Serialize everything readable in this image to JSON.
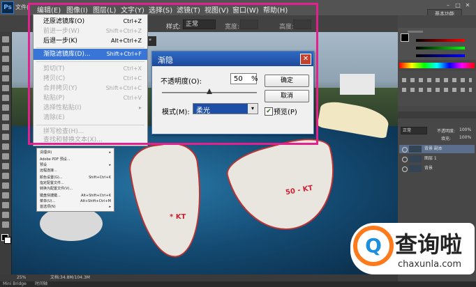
{
  "app": {
    "logo": "Ps",
    "file_menu": "文件(F)",
    "workspace": "基本功能",
    "doc_tab": "B/8) *"
  },
  "menubar": [
    "编辑(E)",
    "图像(I)",
    "图层(L)",
    "文字(Y)",
    "选择(S)",
    "滤镜(T)",
    "视图(V)",
    "窗口(W)",
    "帮助(H)"
  ],
  "options_bar": {
    "style_label": "样式:",
    "style_value": "正常",
    "width_label": "宽度:",
    "height_label": "高度:"
  },
  "edit_menu": {
    "items": [
      {
        "label": "还原滤镜库(O)",
        "shortcut": "Ctrl+Z",
        "state": "normal"
      },
      {
        "label": "前进一步(W)",
        "shortcut": "Shift+Ctrl+Z",
        "state": "disabled"
      },
      {
        "label": "后退一步(K)",
        "shortcut": "Alt+Ctrl+Z",
        "state": "normal"
      },
      {
        "label": "渐隐滤镜库(D)...",
        "shortcut": "Shift+Ctrl+F",
        "state": "highlighted"
      },
      {
        "label": "剪切(T)",
        "shortcut": "Ctrl+X",
        "state": "disabled"
      },
      {
        "label": "拷贝(C)",
        "shortcut": "Ctrl+C",
        "state": "disabled"
      },
      {
        "label": "合并拷贝(Y)",
        "shortcut": "Shift+Ctrl+C",
        "state": "disabled"
      },
      {
        "label": "粘贴(P)",
        "shortcut": "Ctrl+V",
        "state": "disabled"
      },
      {
        "label": "选择性粘贴(I)",
        "shortcut": "▸",
        "state": "disabled"
      },
      {
        "label": "清除(E)",
        "shortcut": "",
        "state": "disabled"
      },
      {
        "label": "拼写检查(H)...",
        "shortcut": "",
        "state": "disabled"
      },
      {
        "label": "查找和替换文本(X)...",
        "shortcut": "",
        "state": "disabled"
      }
    ]
  },
  "menu2": {
    "items": [
      {
        "label": "清理(R)",
        "shortcut": "▸"
      },
      {
        "label": "Adobe PDF 预设...",
        "shortcut": ""
      },
      {
        "label": "预设",
        "shortcut": "▸"
      },
      {
        "label": "远程连接...",
        "shortcut": ""
      },
      {
        "label": "颜色设置(G)...",
        "shortcut": "Shift+Ctrl+K"
      },
      {
        "label": "指定配置文件...",
        "shortcut": ""
      },
      {
        "label": "转换为配置文件(V)...",
        "shortcut": ""
      },
      {
        "label": "键盘快捷键...",
        "shortcut": "Alt+Shift+Ctrl+K"
      },
      {
        "label": "菜单(U)...",
        "shortcut": "Alt+Shift+Ctrl+M"
      },
      {
        "label": "首选项(N)",
        "shortcut": "▸"
      }
    ]
  },
  "fade_dialog": {
    "title": "渐隐",
    "close": "✕",
    "opacity_label": "不透明度(O):",
    "opacity_value": "50",
    "opacity_unit": "%",
    "opacity_fraction": 0.5,
    "mode_label": "模式(M):",
    "mode_value": "柔光",
    "ok_label": "确定",
    "cancel_label": "取消",
    "preview_label": "预览(P)",
    "preview_checked": true
  },
  "layers": {
    "mode": "正常",
    "opacity_label": "不透明度:",
    "opacity": "100%",
    "fill_label": "填充:",
    "fill": "100%",
    "items": [
      "背景 副本",
      "图层 1",
      "背景"
    ]
  },
  "status": {
    "zoom": "25%",
    "doc": "文档:34.8M/104.3M"
  },
  "bottom": {
    "tab1": "Mini Bridge",
    "tab2": "时间轴"
  },
  "boat_labels": [
    "* KT",
    "50 - KT"
  ],
  "watermark": {
    "cn": "查询啦",
    "en": "chaxunla.com",
    "q": "Q"
  },
  "colors": {
    "highlight_frame": "#e2218e",
    "menu_highlight": "#3875d7",
    "watermark_orange": "#ff7a1a",
    "watermark_blue": "#1c8fdc"
  }
}
